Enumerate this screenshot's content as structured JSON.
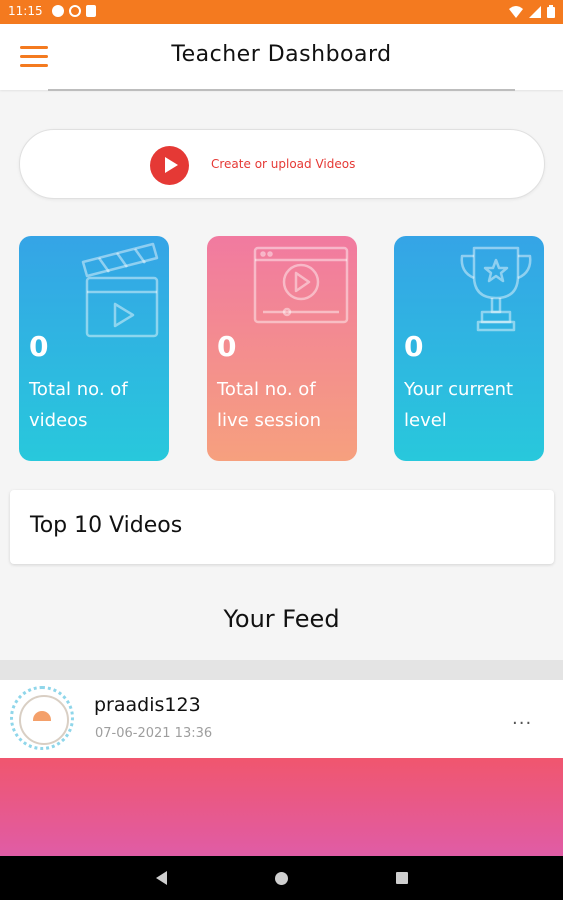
{
  "status_bar": {
    "time": "11:15",
    "left_icons": [
      "notification-dot-icon",
      "vpn-ring-icon",
      "sd-card-icon"
    ],
    "right_icons": [
      "wifi-icon",
      "signal-icon",
      "battery-icon"
    ]
  },
  "app_bar": {
    "title": "Teacher Dashboard",
    "menu_icon": "hamburger-menu-icon"
  },
  "upload": {
    "label": "Create or upload Videos",
    "icon": "play-button-icon"
  },
  "stats": [
    {
      "count": "0",
      "label": "Total no. of videos",
      "icon": "clapperboard-icon"
    },
    {
      "count": "0",
      "label": "Total no. of live session",
      "icon": "video-player-icon"
    },
    {
      "count": "0",
      "label": "Your current level",
      "icon": "trophy-icon"
    }
  ],
  "top_videos": {
    "title": "Top 10 Videos"
  },
  "feed": {
    "title": "Your Feed",
    "post": {
      "user": "praadis123",
      "date": "07-06-2021 13:36",
      "more": "..."
    }
  },
  "colors": {
    "status_bar": "#f47a1f",
    "accent": "#f47a1f",
    "red": "#e53935",
    "blue_card": "#2fb5e0",
    "pink_card": "#f28a92"
  }
}
